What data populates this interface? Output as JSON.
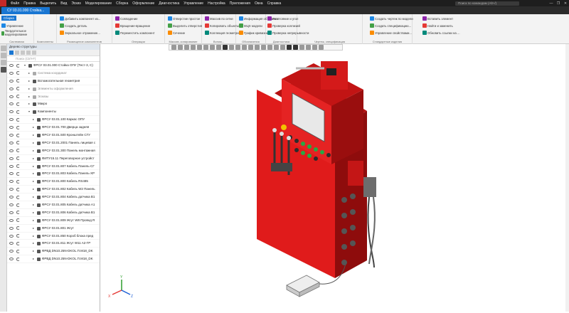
{
  "titlebar": {
    "menu": [
      "Файл",
      "Правка",
      "Выделить",
      "Вид",
      "Эскиз",
      "Моделирование",
      "Сборка",
      "Оформление",
      "Диагностика",
      "Управление",
      "Настройка",
      "Приложения",
      "Окна",
      "Справка"
    ],
    "search_placeholder": "Поиск по командам (Alt+/)",
    "controls": [
      "—",
      "❐",
      "✕"
    ]
  },
  "tabs": {
    "active": "СУ 03.01.000 Стойка...",
    "second": "Сборка"
  },
  "ribbon": {
    "left_buttons": [
      "Управление",
      "Твердотельное моделирование"
    ],
    "commands": [
      {
        "label": "Добавить компонент из...",
        "group": 2
      },
      {
        "label": "Создать деталь",
        "group": 2
      },
      {
        "label": "Зеркальное отражение...",
        "group": 2
      },
      {
        "label": "Совпадение",
        "group": 3
      },
      {
        "label": "Вращение-вращение",
        "group": 3
      },
      {
        "label": "Переместить компонент",
        "group": 3
      },
      {
        "label": "Отверстие простое",
        "group": 4
      },
      {
        "label": "Выделить отверстия",
        "group": 4
      },
      {
        "label": "Сечение",
        "group": 4
      },
      {
        "label": "Массив по сетке",
        "group": 5
      },
      {
        "label": "Копировать объекты",
        "group": 5
      },
      {
        "label": "Коллекция геометрии",
        "group": 5
      },
      {
        "label": "Информация об объекте",
        "group": 6
      },
      {
        "label": "МЦХ модели",
        "group": 6
      },
      {
        "label": "График кривизны",
        "group": 6
      },
      {
        "label": "Расстояние и угол",
        "group": 6
      },
      {
        "label": "Проверка коллизий",
        "group": 6
      },
      {
        "label": "Проверка непрерывности",
        "group": 6
      },
      {
        "label": "Создать чертеж по модели",
        "group": 7
      },
      {
        "label": "Создать спецификацию...",
        "group": 7
      },
      {
        "label": "Управление свойствами...",
        "group": 7
      },
      {
        "label": "Вставить элемент",
        "group": 8
      },
      {
        "label": "Найти и заменить",
        "group": 8
      },
      {
        "label": "Обновить ссылки на ...",
        "group": 8
      }
    ],
    "group_labels": [
      "Системная",
      "Компоненты",
      "Размещение компонентов",
      "Операции",
      "Массив, копирование",
      "Вспом...",
      "Обозначения",
      "Диагностика",
      "Чертеж, спецификация",
      "Стандартные изделия"
    ]
  },
  "tree": {
    "header": "Дерево структуры",
    "filter_placeholder": "Поиск (Ctrl+F)",
    "rows": [
      {
        "label": "ФРСУ 03.01.000 Стойка ОПУ (Тест-3, С)",
        "indent": 0,
        "dim": false,
        "caret": "▾"
      },
      {
        "label": "Система координат",
        "indent": 1,
        "dim": true,
        "caret": "▸"
      },
      {
        "label": "Вспомогательная геометрия",
        "indent": 1,
        "dim": false,
        "caret": "▸"
      },
      {
        "label": "Элементы оформления",
        "indent": 1,
        "dim": true,
        "caret": "▸"
      },
      {
        "label": "Эскизы",
        "indent": 1,
        "dim": true,
        "caret": "▸"
      },
      {
        "label": "Макро",
        "indent": 1,
        "dim": false,
        "caret": "▸"
      },
      {
        "label": "Компоненты",
        "indent": 1,
        "dim": false,
        "caret": "▾"
      },
      {
        "label": "ФРСУ 03.01.100 Каркас ОПУ",
        "indent": 2,
        "dim": false,
        "caret": "▸"
      },
      {
        "label": "ФРСУ 03.01.700 Дверца задняя",
        "indent": 2,
        "dim": false,
        "caret": "▸"
      },
      {
        "label": "ФРСУ 03.01.500 Кронштейн СГУ",
        "indent": 2,
        "dim": false,
        "caret": "▸"
      },
      {
        "label": "ФРСУ 03.01.2001 Панель лицевая с",
        "indent": 2,
        "dim": false,
        "caret": "▸"
      },
      {
        "label": "ФРСУ 03.01.300 Панель монтажная",
        "indent": 2,
        "dim": false,
        "caret": "▸"
      },
      {
        "label": "ФИТУ15.11 Переговорное устройст",
        "indent": 2,
        "dim": false,
        "caret": "▸"
      },
      {
        "label": "ФРСУ 03.01.807 Кабель Панель-СГ",
        "indent": 2,
        "dim": false,
        "caret": "▸"
      },
      {
        "label": "ФРСУ 03.01.803 Кабель Панель-ХР",
        "indent": 2,
        "dim": false,
        "caret": "▸"
      },
      {
        "label": "ФРСУ 03.01.800 Кабель RS485",
        "indent": 2,
        "dim": false,
        "caret": "▸"
      },
      {
        "label": "ФРСУ 03.01.802 Кабель W2 Панель",
        "indent": 2,
        "dim": false,
        "caret": "▸"
      },
      {
        "label": "ФРСУ 03.01.804 Кабель датчика В1",
        "indent": 2,
        "dim": false,
        "caret": "▸"
      },
      {
        "label": "ФРСУ 03.01.805 Кабель датчика А1",
        "indent": 2,
        "dim": false,
        "caret": "▸"
      },
      {
        "label": "ФРСУ 03.01.806 Кабель датчика В1",
        "indent": 2,
        "dim": false,
        "caret": "▸"
      },
      {
        "label": "ФРСУ 03.01.809 Жгут W8 Провод R",
        "indent": 2,
        "dim": false,
        "caret": "▸"
      },
      {
        "label": "ФРСУ 03.01.801 Жгут",
        "indent": 2,
        "dim": false,
        "caret": "▸"
      },
      {
        "label": "ФРСУ 03.01.850 Короб блока пред",
        "indent": 2,
        "dim": false,
        "caret": "▸"
      },
      {
        "label": "ФРСУ 03.01.811 Жгут W11 A2-ГР",
        "indent": 2,
        "dim": false,
        "caret": "▸"
      },
      {
        "label": "ФРВД DN10.25N-DKOL.П.М18_DK",
        "indent": 2,
        "dim": false,
        "caret": "▸"
      },
      {
        "label": "ФРВД DN10.25N-DKOL.П.М18_DK",
        "indent": 2,
        "dim": false,
        "caret": "▸"
      }
    ]
  },
  "colors": {
    "accent": "#1976d2",
    "model_red": "#e01b1b",
    "model_dark_red": "#a50d0d",
    "titlebar": "#1e1e1e"
  },
  "axis_labels": [
    "Y",
    "X",
    "Z"
  ]
}
